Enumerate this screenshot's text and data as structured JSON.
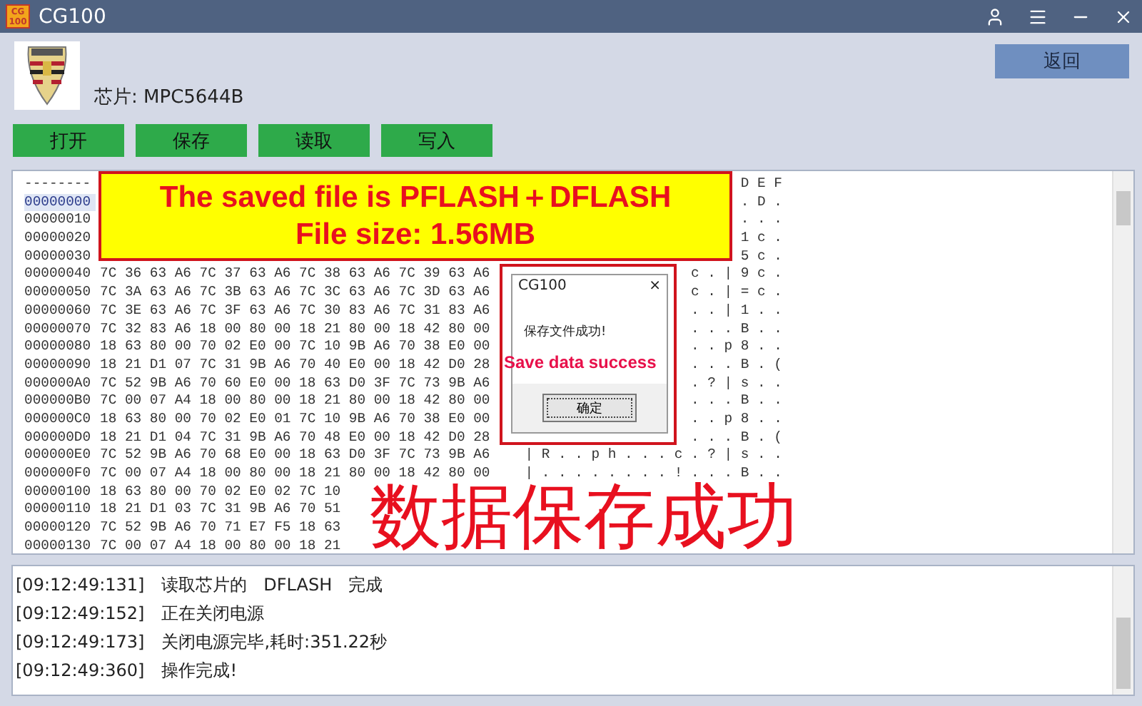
{
  "window": {
    "title": "CG100",
    "icon_lines": [
      "CG",
      "100"
    ]
  },
  "chip_label": "芯片: MPC5644B",
  "back_button": "返回",
  "actions": [
    "打开",
    "保存",
    "读取",
    "写入"
  ],
  "hex_dump": {
    "rows": [
      {
        "address": "--------",
        "ascii": "D E F"
      },
      {
        "address": "00000000",
        "ascii": ". D .",
        "selected": true
      },
      {
        "address": "00000010",
        "ascii": ". . .",
        "selected": false
      },
      {
        "address": "00000020",
        "ascii": "1 c .",
        "selected": false
      },
      {
        "address": "00000030",
        "ascii": "5 c .",
        "selected": false
      },
      {
        "address": "00000040",
        "hex": "7C 36 63 A6 7C 37 63 A6 7C 38 63 A6 7C 39 63 A6",
        "ascii": "c . | 9 c .",
        "selected": false
      },
      {
        "address": "00000050",
        "hex": "7C 3A 63 A6 7C 3B 63 A6 7C 3C 63 A6 7C 3D 63 A6",
        "ascii": "c . | = c .",
        "selected": false
      },
      {
        "address": "00000060",
        "hex": "7C 3E 63 A6 7C 3F 63 A6 7C 30 83 A6 7C 31 83 A6",
        "ascii": ". . | 1 . .",
        "selected": false
      },
      {
        "address": "00000070",
        "hex": "7C 32 83 A6 18 00 80 00 18 21 80 00 18 42 80 00",
        "ascii": ". . . B . .",
        "selected": false
      },
      {
        "address": "00000080",
        "hex": "18 63 80 00 70 02 E0 00 7C 10 9B A6 70 38 E0 00",
        "ascii": ". . p 8 . .",
        "selected": false
      },
      {
        "address": "00000090",
        "hex": "18 21 D1 07 7C 31 9B A6 70 40 E0 00 18 42 D0 28",
        "ascii": ". . . B . (",
        "selected": false
      },
      {
        "address": "000000A0",
        "hex": "7C 52 9B A6 70 60 E0 00 18 63 D0 3F 7C 73 9B A6",
        "ascii": ". ? | s . .",
        "selected": false
      },
      {
        "address": "000000B0",
        "hex": "7C 00 07 A4 18 00 80 00 18 21 80 00 18 42 80 00",
        "ascii": ". . . B . .",
        "selected": false
      },
      {
        "address": "000000C0",
        "hex": "18 63 80 00 70 02 E0 01 7C 10 9B A6 70 38 E0 00",
        "ascii": ". . p 8 . .",
        "selected": false
      },
      {
        "address": "000000D0",
        "hex": "18 21 D1 04 7C 31 9B A6 70 48 E0 00 18 42 D0 28",
        "ascii": ". . . B . (",
        "selected": false
      },
      {
        "address": "000000E0",
        "hex": "7C 52 9B A6 70 68 E0 00 18 63 D0 3F 7C 73 9B A6",
        "ascii": "| R . . p h . . . c . ? | s . .",
        "selected": false
      },
      {
        "address": "000000F0",
        "hex": "7C 00 07 A4 18 00 80 00 18 21 80 00 18 42 80 00",
        "ascii": "| . . . . . . . . ! . . . B . .",
        "selected": false
      },
      {
        "address": "00000100",
        "hex": "18 63 80 00 70 02 E0 02 7C 10",
        "selected": false
      },
      {
        "address": "00000110",
        "hex": "18 21 D1 03 7C 31 9B A6 70 51",
        "selected": false
      },
      {
        "address": "00000120",
        "hex": "7C 52 9B A6 70 71 E7 F5 18 63",
        "selected": false
      },
      {
        "address": "00000130",
        "hex": "7C 00 07 A4 18 00 80 00 18 21",
        "selected": false
      }
    ]
  },
  "annotation_banner": [
    "The saved file is PFLASH＋DFLASH",
    "File size: 1.56MB"
  ],
  "dialog": {
    "title": "CG100",
    "close": "×",
    "message": "保存文件成功!",
    "annotation": "Save data success",
    "ok_button": "确定"
  },
  "big_annotation": "数据保存成功",
  "log": [
    {
      "time": "[09:12:49:131]",
      "message": "读取芯片的   DFLASH   完成"
    },
    {
      "time": "[09:12:49:152]",
      "message": "正在关闭电源"
    },
    {
      "time": "[09:12:49:173]",
      "message": "关闭电源完毕,耗时:351.22秒"
    },
    {
      "time": "[09:12:49:360]",
      "message": "操作完成!"
    }
  ]
}
